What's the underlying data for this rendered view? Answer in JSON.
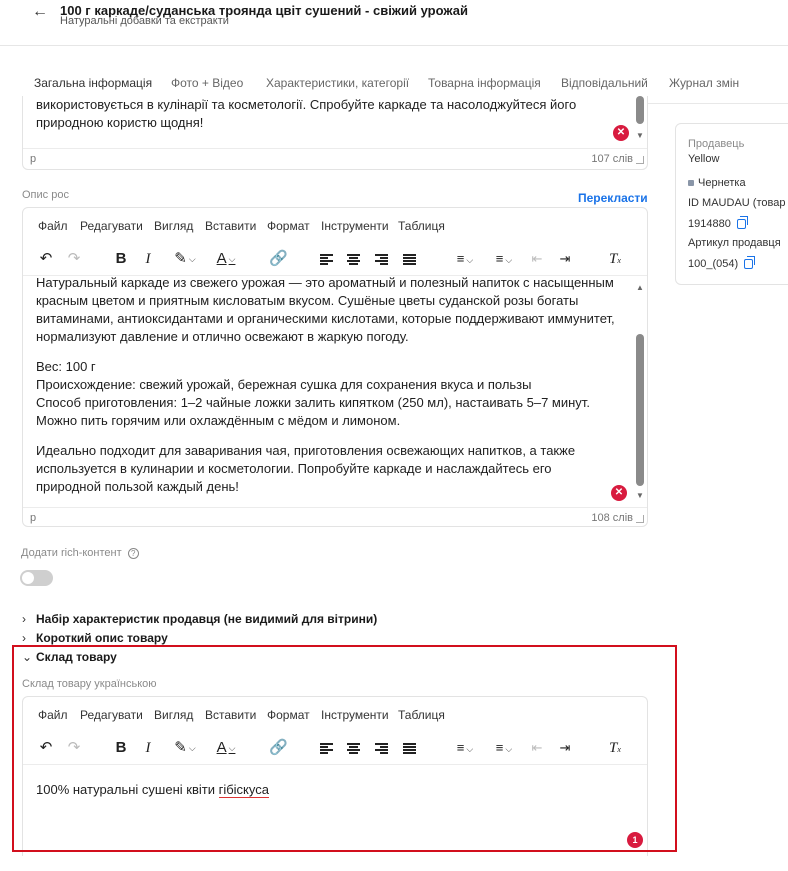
{
  "header": {
    "back_icon": "arrow-left-icon",
    "title": "100 г каркаде/суданська троянда цвіт сушений - свіжий урожай",
    "subtitle": "Натуральні добавки та екстракти"
  },
  "tabs": [
    {
      "label": "Загальна інформація",
      "active": true
    },
    {
      "label": "Фото + Відео"
    },
    {
      "label": "Характеристики, категорії"
    },
    {
      "label": "Товарна інформація"
    },
    {
      "label": "Відповідальний"
    },
    {
      "label": "Журнал змін"
    }
  ],
  "editor_top": {
    "text_lines": [
      "використовується в кулінарії та косметології. Спробуйте каркаде та насолоджуйтеся його",
      "природною користю щодня!"
    ],
    "status_tag": "p",
    "word_count": "107 слів"
  },
  "editor_ru": {
    "label": "Опис рос",
    "translate_label": "Перекласти",
    "menu": [
      "Файл",
      "Редагувати",
      "Вигляд",
      "Вставити",
      "Формат",
      "Інструменти",
      "Таблиця"
    ],
    "paragraphs": [
      [
        "Натуральный каркаде из свежего урожая — это ароматный и полезный напиток с насыщенным",
        "красным цветом и приятным кисловатым вкусом. Сушёные цветы суданской розы богаты",
        "витаминами, антиоксидантами и органическими кислотами, которые поддерживают иммунитет,",
        "нормализуют давление и отлично освежают в жаркую погоду."
      ],
      [
        "Вес: 100 г",
        "Происхождение: свежий урожай, бережная сушка для сохранения вкуса и пользы",
        "Способ приготовления: 1–2 чайные ложки залить кипятком (250 мл), настаивать 5–7 минут.",
        "Можно пить горячим или охлаждённым с мёдом и лимоном."
      ],
      [
        "Идеально подходит для заваривания чая, приготовления освежающих напитков, а также",
        "используется в кулинарии и косметологии. Попробуйте каркаде и наслаждайтесь его",
        "природной пользой каждый день!"
      ]
    ],
    "status_tag": "p",
    "word_count": "108 слів"
  },
  "side_card": {
    "seller_label": "Продавець",
    "seller_value": "Yellow",
    "status": "Чернетка",
    "id_label": "ID MAUDAU (товар",
    "id_value": "1914880",
    "article_label": "Артикул продавця",
    "article_value": "100_(054)"
  },
  "rich_content": {
    "label": "Додати rich-контент",
    "help_icon": "question-circle-icon",
    "enabled": false
  },
  "sections": [
    {
      "label": "Набір характеристик продавця (не видимий для вітрини)",
      "expanded": false
    },
    {
      "label": "Короткий опис товару",
      "expanded": false
    },
    {
      "label": "Склад товару",
      "expanded": true
    }
  ],
  "composition": {
    "label": "Склад товару українською",
    "menu": [
      "Файл",
      "Редагувати",
      "Вигляд",
      "Вставити",
      "Формат",
      "Інструменти",
      "Таблиця"
    ],
    "text_before": "100% натуральні сушені квіти ",
    "text_misspelled": "гібіскуса",
    "error_count": "1"
  },
  "colors": {
    "accent": "#1a73e8",
    "error": "#d81b3f",
    "highlight_border": "#d20f1d"
  }
}
